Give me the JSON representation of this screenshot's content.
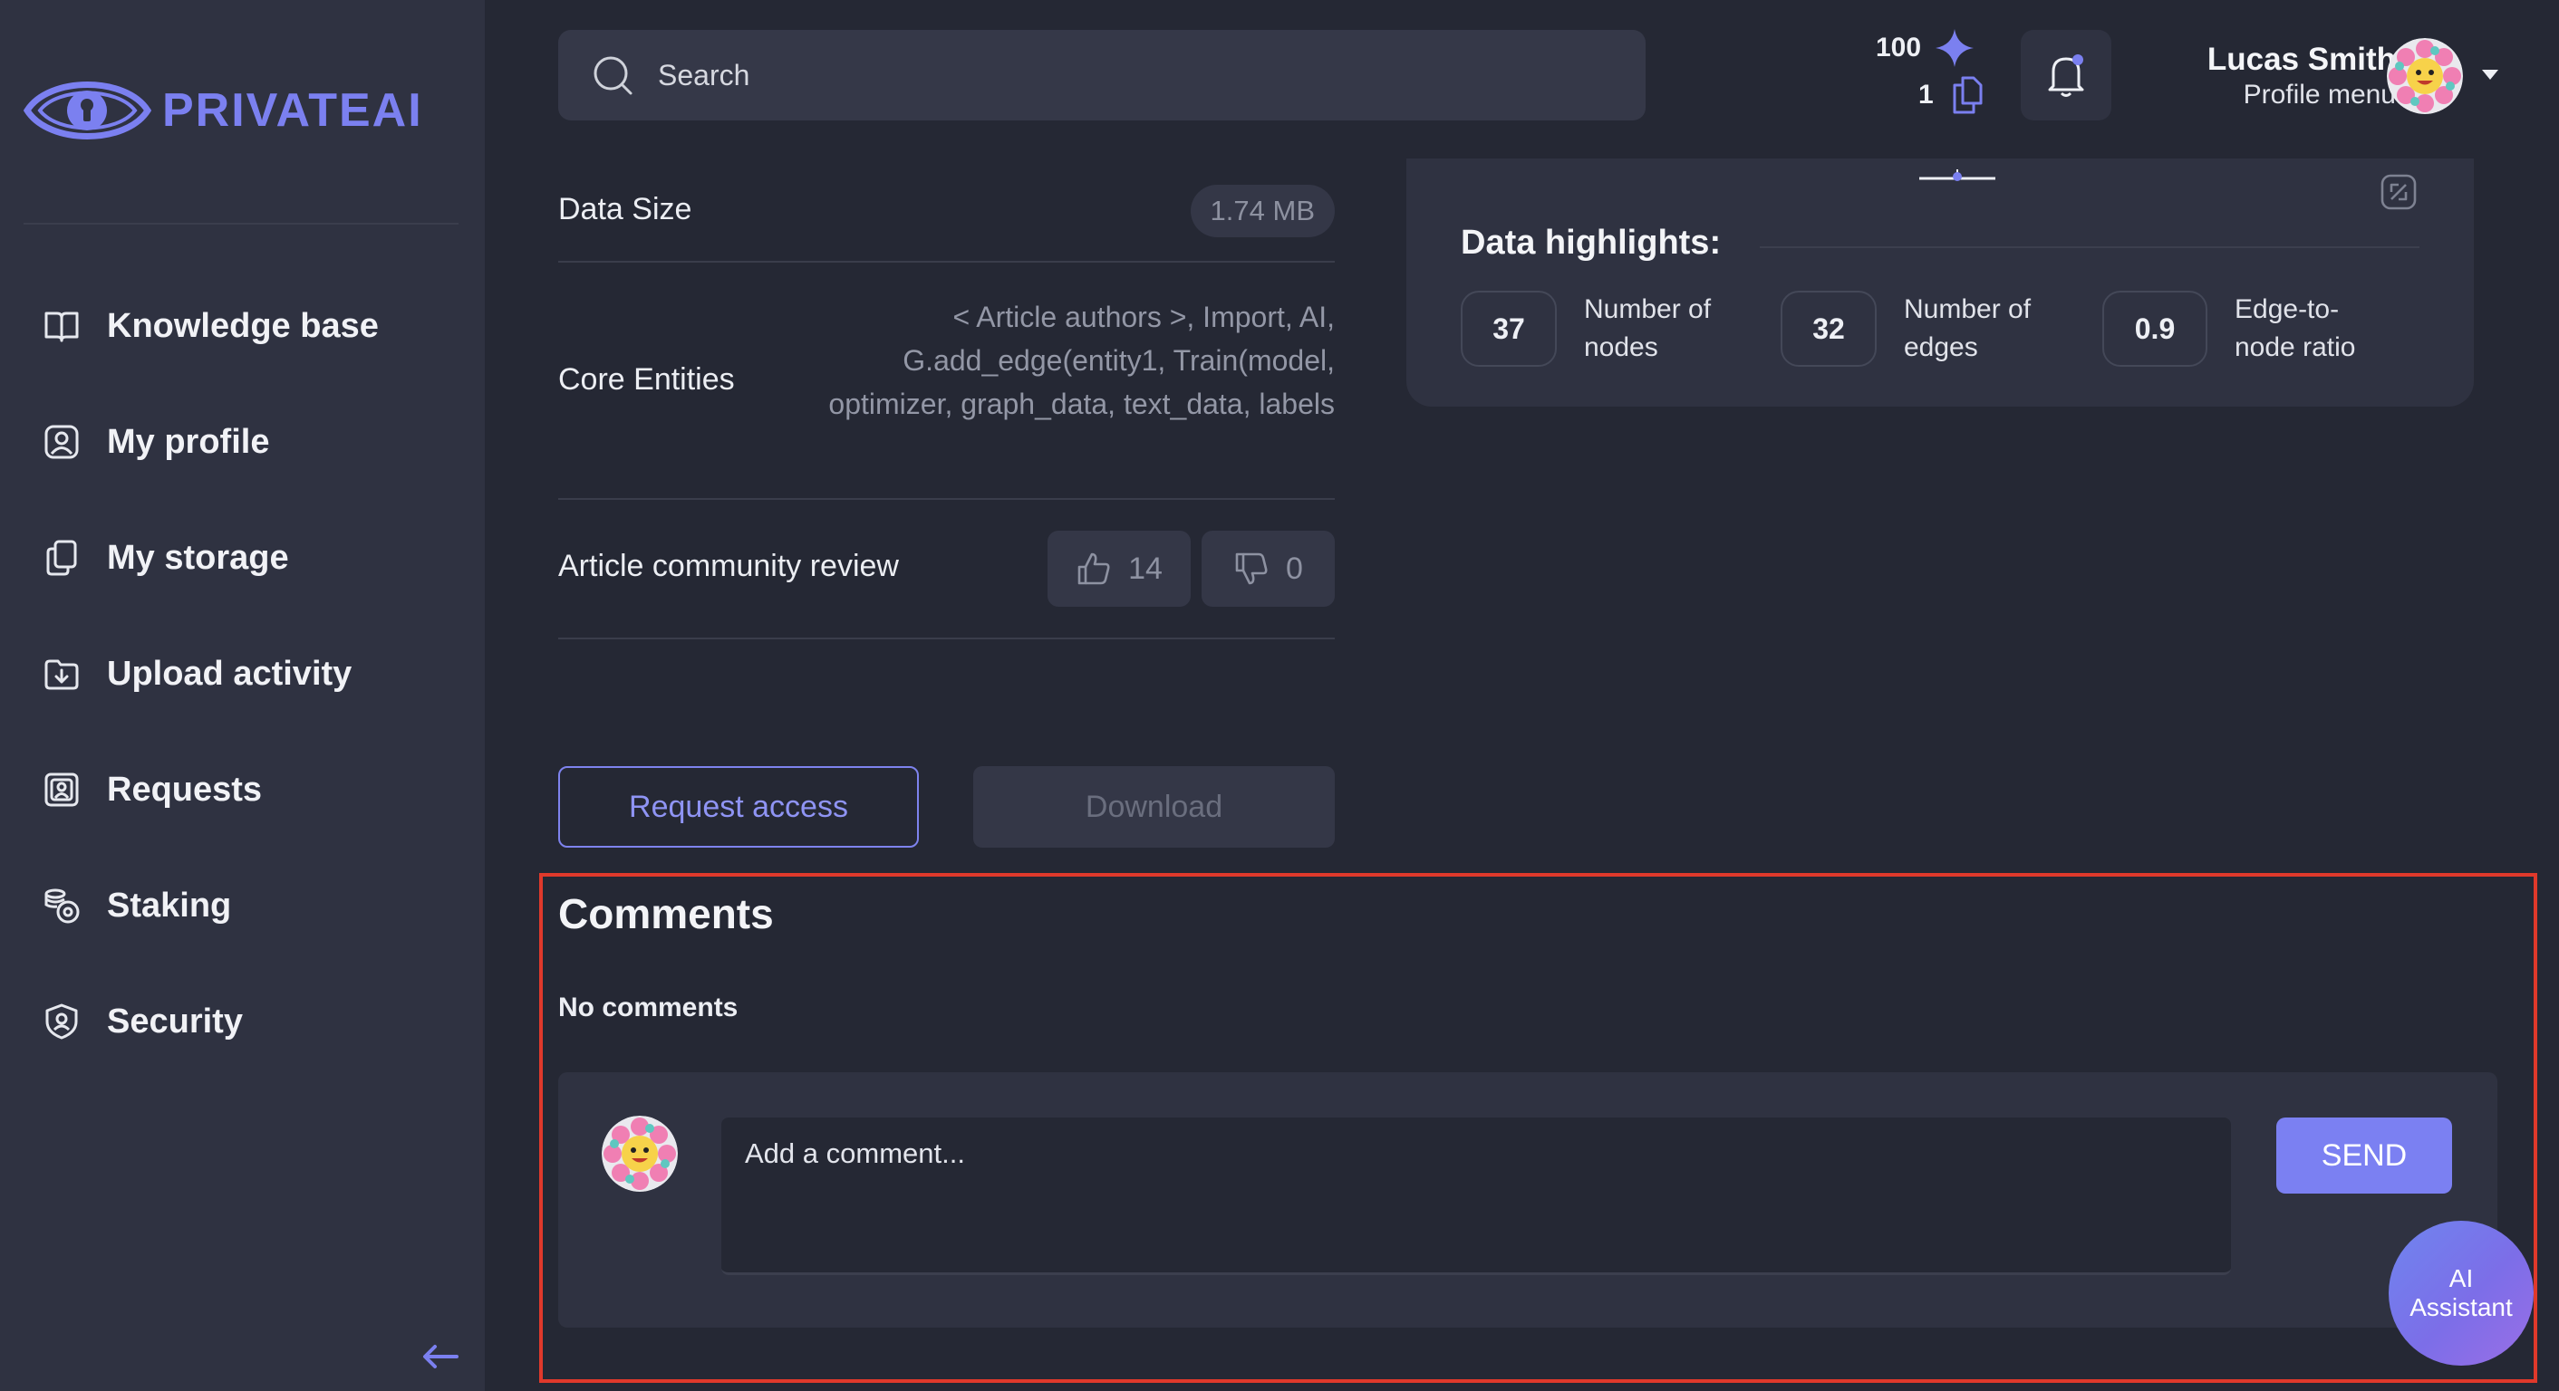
{
  "brand": {
    "name": "PRIVATEAI",
    "accent": "#7b80f0"
  },
  "sidebar": {
    "items": [
      {
        "label": "Knowledge base",
        "icon": "book-icon"
      },
      {
        "label": "My profile",
        "icon": "user-icon"
      },
      {
        "label": "My storage",
        "icon": "files-icon"
      },
      {
        "label": "Upload activity",
        "icon": "upload-icon"
      },
      {
        "label": "Requests",
        "icon": "request-icon"
      },
      {
        "label": "Staking",
        "icon": "staking-icon"
      },
      {
        "label": "Security",
        "icon": "shield-icon"
      }
    ],
    "collapse_icon": "arrow-left-icon"
  },
  "header": {
    "search_placeholder": "Search",
    "credits": {
      "points": "100",
      "files": "1"
    },
    "user": {
      "name": "Lucas Smith",
      "menu_label": "Profile menu"
    }
  },
  "details": {
    "data_size_label": "Data Size",
    "data_size_value": "1.74 MB",
    "core_entities_label": "Core Entities",
    "core_entities_value": "< Article authors >, Import, AI, G.add_edge(entity1, Train(model, optimizer, graph_data, text_data, labels",
    "review_label": "Article community review",
    "likes": "14",
    "dislikes": "0"
  },
  "actions": {
    "request_access": "Request access",
    "download": "Download"
  },
  "highlights": {
    "title": "Data highlights:",
    "metrics": [
      {
        "value": "37",
        "label_line1": "Number of",
        "label_line2": "nodes"
      },
      {
        "value": "32",
        "label_line1": "Number of",
        "label_line2": "edges"
      },
      {
        "value": "0.9",
        "label_line1": "Edge-to-",
        "label_line2": "node ratio"
      }
    ]
  },
  "comments": {
    "title": "Comments",
    "empty_text": "No comments",
    "input_placeholder": "Add a comment...",
    "send_label": "SEND"
  },
  "assistant": {
    "line1": "AI",
    "line2": "Assistant"
  }
}
